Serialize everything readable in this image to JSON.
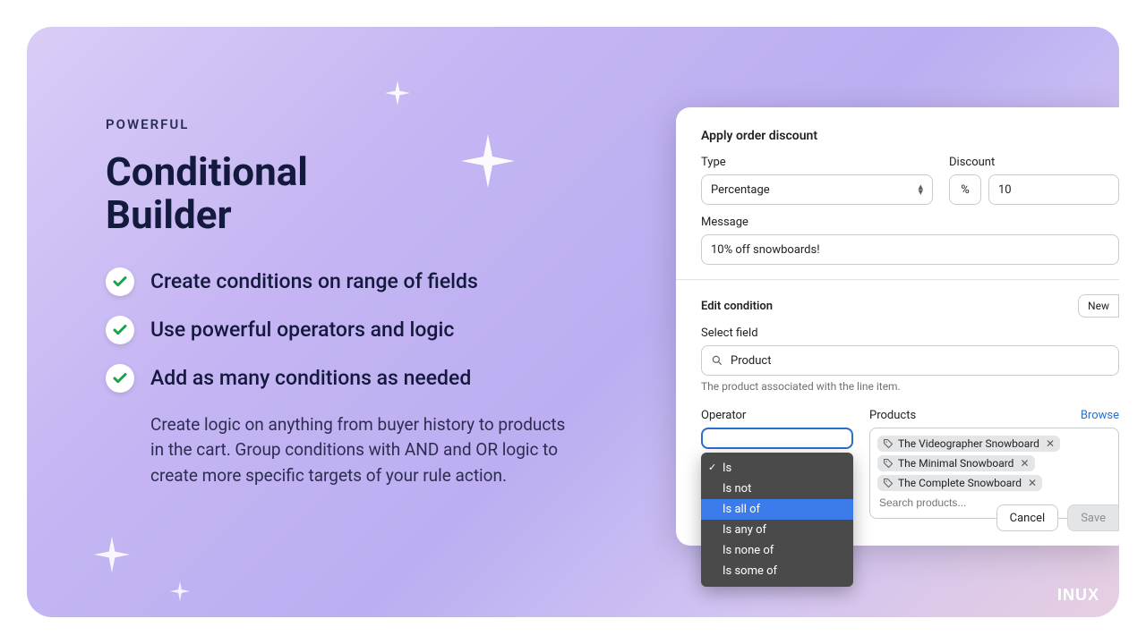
{
  "marketing": {
    "eyebrow": "POWERFUL",
    "headline_l1": "Conditional",
    "headline_l2": "Builder",
    "bullets": [
      "Create conditions on range of fields",
      "Use powerful operators and logic",
      "Add as many conditions as needed"
    ],
    "description": "Create logic on anything from buyer history to products in the cart. Group conditions with AND and OR logic to create more specific targets of your rule action."
  },
  "panel": {
    "title": "Apply order discount",
    "type_label": "Type",
    "type_value": "Percentage",
    "discount_label": "Discount",
    "discount_unit": "%",
    "discount_value": "10",
    "message_label": "Message",
    "message_value": "10% off snowboards!",
    "edit_condition_label": "Edit condition",
    "new_button": "New",
    "select_field_label": "Select field",
    "select_field_value": "Product",
    "select_field_help": "The product associated with the line item.",
    "operator_label": "Operator",
    "operator_options": [
      {
        "label": "Is",
        "checked": true,
        "selected": false
      },
      {
        "label": "Is not",
        "checked": false,
        "selected": false
      },
      {
        "label": "Is all of",
        "checked": false,
        "selected": true
      },
      {
        "label": "Is any of",
        "checked": false,
        "selected": false
      },
      {
        "label": "Is none of",
        "checked": false,
        "selected": false
      },
      {
        "label": "Is some of",
        "checked": false,
        "selected": false
      }
    ],
    "products_label": "Products",
    "browse_label": "Browse",
    "product_tags": [
      "The Videographer Snowboard",
      "The Minimal Snowboard",
      "The Complete Snowboard"
    ],
    "products_placeholder": "Search products...",
    "cancel": "Cancel",
    "save": "Save"
  },
  "logo": "INUX"
}
